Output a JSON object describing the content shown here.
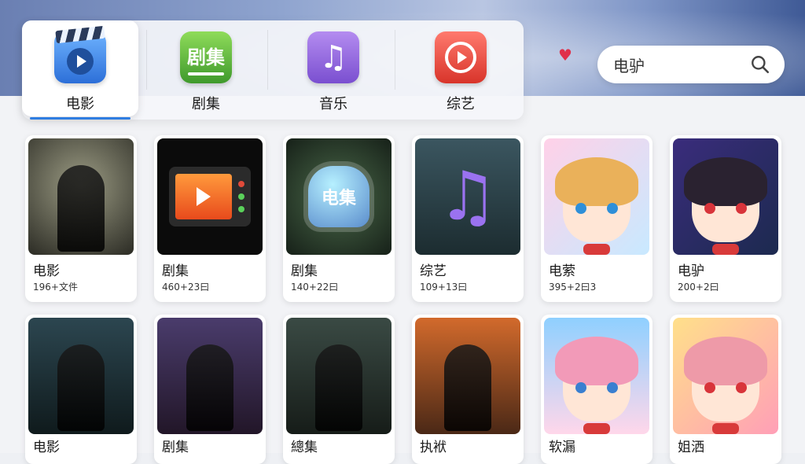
{
  "nav": {
    "tabs": [
      {
        "label": "电影",
        "icon": "movie-clapper-icon",
        "active": true
      },
      {
        "label": "剧集",
        "icon": "drama-icon",
        "active": false
      },
      {
        "label": "音乐",
        "icon": "music-note-icon",
        "active": false
      },
      {
        "label": "综艺",
        "icon": "variety-play-icon",
        "active": false
      }
    ],
    "drama_icon_text": "剧集"
  },
  "search": {
    "value": "电驴",
    "icon": "search-icon"
  },
  "favorite_icon": "heart-icon",
  "grid": {
    "row1": [
      {
        "title": "电影",
        "subtitle": "196+文件",
        "thumb": "silhouette-rider-on-donkey"
      },
      {
        "title": "剧集",
        "subtitle": "460+23曰",
        "thumb": "retro-tv-play"
      },
      {
        "title": "剧集",
        "subtitle": "140+22曰",
        "thumb": "glowing-jar",
        "thumb_text": "电集"
      },
      {
        "title": "综艺",
        "subtitle": "109+13曰",
        "thumb": "purple-music-note"
      },
      {
        "title": "电萦",
        "subtitle": "395+2曰3",
        "thumb": "anime-girl-blonde"
      },
      {
        "title": "电驴",
        "subtitle": "200+2曰",
        "thumb": "anime-girl-headphones"
      }
    ],
    "row2": [
      {
        "title": "电影",
        "thumb": "donkey-head-detective"
      },
      {
        "title": "剧集",
        "thumb": "moonlit-figure"
      },
      {
        "title": "總集",
        "thumb": "donkey-head-green-coat"
      },
      {
        "title": "执袱",
        "thumb": "donkey-head-city-fire"
      },
      {
        "title": "软漏",
        "thumb": "anime-girl-pink-twintails"
      },
      {
        "title": "姐洒",
        "thumb": "anime-girl-pink-hair"
      }
    ]
  }
}
